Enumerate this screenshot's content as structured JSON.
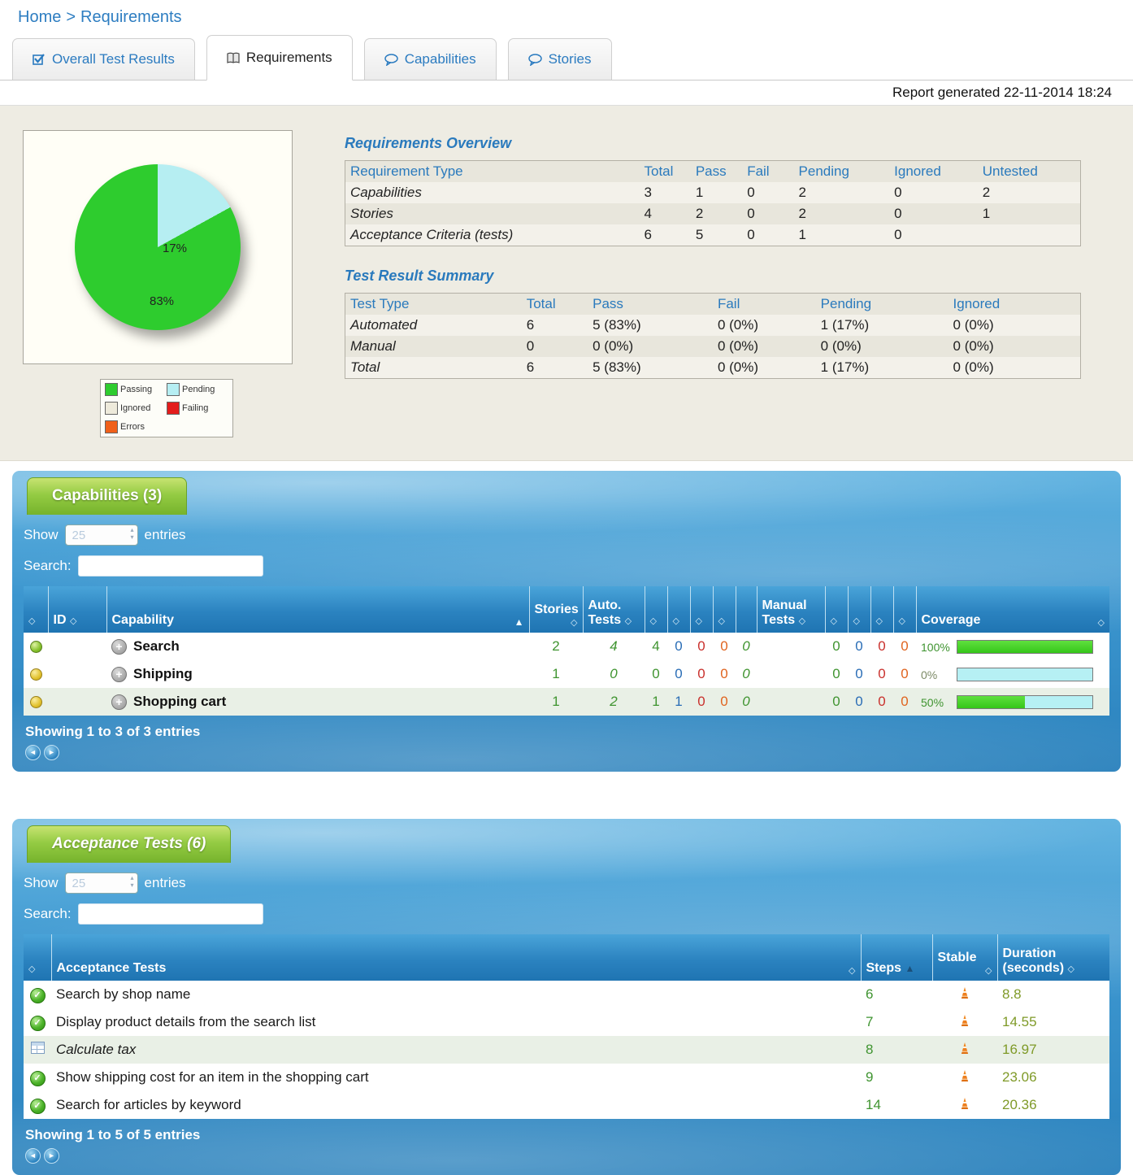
{
  "page": {
    "breadcrumb": {
      "home": "Home",
      "sep": ">",
      "current": "Requirements"
    },
    "report_generated": "Report generated 22-11-2014 18:24"
  },
  "tabs": [
    {
      "label": "Overall Test Results"
    },
    {
      "label": "Requirements"
    },
    {
      "label": "Capabilities"
    },
    {
      "label": "Stories"
    }
  ],
  "pie": {
    "passing_pct": 83,
    "pending_pct": 17,
    "passing_label": "83%",
    "pending_label": "17%",
    "colors": {
      "passing": "#2ecc2e",
      "pending": "#b6eef2"
    }
  },
  "legend": {
    "items": [
      {
        "label": "Passing",
        "color": "#2ecc2e"
      },
      {
        "label": "Pending",
        "color": "#b6eef2"
      },
      {
        "label": "Ignored",
        "color": "#eeeadb"
      },
      {
        "label": "Failing",
        "color": "#e31c1c"
      },
      {
        "label": "Errors",
        "color": "#f0601a"
      }
    ]
  },
  "requirements_overview": {
    "title": "Requirements Overview",
    "headers": [
      "Requirement Type",
      "Total",
      "Pass",
      "Fail",
      "Pending",
      "Ignored",
      "Untested"
    ],
    "rows": [
      {
        "type": "Capabilities",
        "values": [
          "3",
          "1",
          "0",
          "2",
          "0",
          "2"
        ]
      },
      {
        "type": "Stories",
        "values": [
          "4",
          "2",
          "0",
          "2",
          "0",
          "1"
        ]
      },
      {
        "type": "Acceptance Criteria (tests)",
        "values": [
          "6",
          "5",
          "0",
          "1",
          "0",
          ""
        ]
      }
    ]
  },
  "test_result_summary": {
    "title": "Test Result Summary",
    "headers": [
      "Test Type",
      "Total",
      "Pass",
      "Fail",
      "Pending",
      "Ignored"
    ],
    "rows": [
      {
        "type": "Automated",
        "values": [
          "6",
          "5 (83%)",
          "0 (0%)",
          "1 (17%)",
          "0 (0%)"
        ]
      },
      {
        "type": "Manual",
        "values": [
          "0",
          "0 (0%)",
          "0 (0%)",
          "0 (0%)",
          "0 (0%)"
        ]
      },
      {
        "type": "Total",
        "values": [
          "6",
          "5 (83%)",
          "0 (0%)",
          "1 (17%)",
          "0 (0%)"
        ]
      }
    ]
  },
  "capabilities": {
    "title": "Capabilities (3)",
    "show_label": "Show",
    "entries_value": "25",
    "entries_label": "entries",
    "search_label": "Search:",
    "headers": {
      "id": "ID",
      "capability": "Capability",
      "stories": "Stories",
      "auto": "Auto. Tests",
      "manual": "Manual Tests",
      "coverage": "Coverage"
    },
    "rows": [
      {
        "status": "green",
        "name": "Search",
        "stories": "2",
        "auto_total": "4",
        "auto": [
          "4",
          "0",
          "0",
          "0",
          "0"
        ],
        "manual_total": "",
        "manual": [
          "0",
          "0",
          "0",
          "0"
        ],
        "coverage_label": "100%",
        "coverage": 100,
        "shaded": false
      },
      {
        "status": "yellow",
        "name": "Shipping",
        "stories": "1",
        "auto_total": "0",
        "auto": [
          "0",
          "0",
          "0",
          "0",
          "0"
        ],
        "manual_total": "",
        "manual": [
          "0",
          "0",
          "0",
          "0"
        ],
        "coverage_label": "0%",
        "coverage": 0,
        "shaded": false
      },
      {
        "status": "yellow",
        "name": "Shopping cart",
        "stories": "1",
        "auto_total": "2",
        "auto": [
          "1",
          "1",
          "0",
          "0",
          "0"
        ],
        "manual_total": "",
        "manual": [
          "0",
          "0",
          "0",
          "0"
        ],
        "coverage_label": "50%",
        "coverage": 50,
        "shaded": true
      }
    ],
    "showing": "Showing 1 to 3 of 3 entries"
  },
  "acceptance": {
    "title": "Acceptance Tests (6)",
    "show_label": "Show",
    "entries_value": "25",
    "entries_label": "entries",
    "search_label": "Search:",
    "headers": {
      "tests": "Acceptance Tests",
      "steps": "Steps",
      "stable": "Stable",
      "duration": "Duration (seconds)"
    },
    "rows": [
      {
        "icon": "pass",
        "name": "Search by shop name",
        "steps": "6",
        "duration": "8.8",
        "shaded": false,
        "italic": false
      },
      {
        "icon": "pass",
        "name": "Display product details from the search list",
        "steps": "7",
        "duration": "14.55",
        "shaded": false,
        "italic": false
      },
      {
        "icon": "pending",
        "name": "Calculate tax",
        "steps": "8",
        "duration": "16.97",
        "shaded": true,
        "italic": true
      },
      {
        "icon": "pass",
        "name": "Show shipping cost for an item in the shopping cart",
        "steps": "9",
        "duration": "23.06",
        "shaded": false,
        "italic": false
      },
      {
        "icon": "pass",
        "name": "Search for articles by keyword",
        "steps": "14",
        "duration": "20.36",
        "shaded": false,
        "italic": false
      }
    ],
    "showing": "Showing 1 to 5 of 5 entries"
  }
}
